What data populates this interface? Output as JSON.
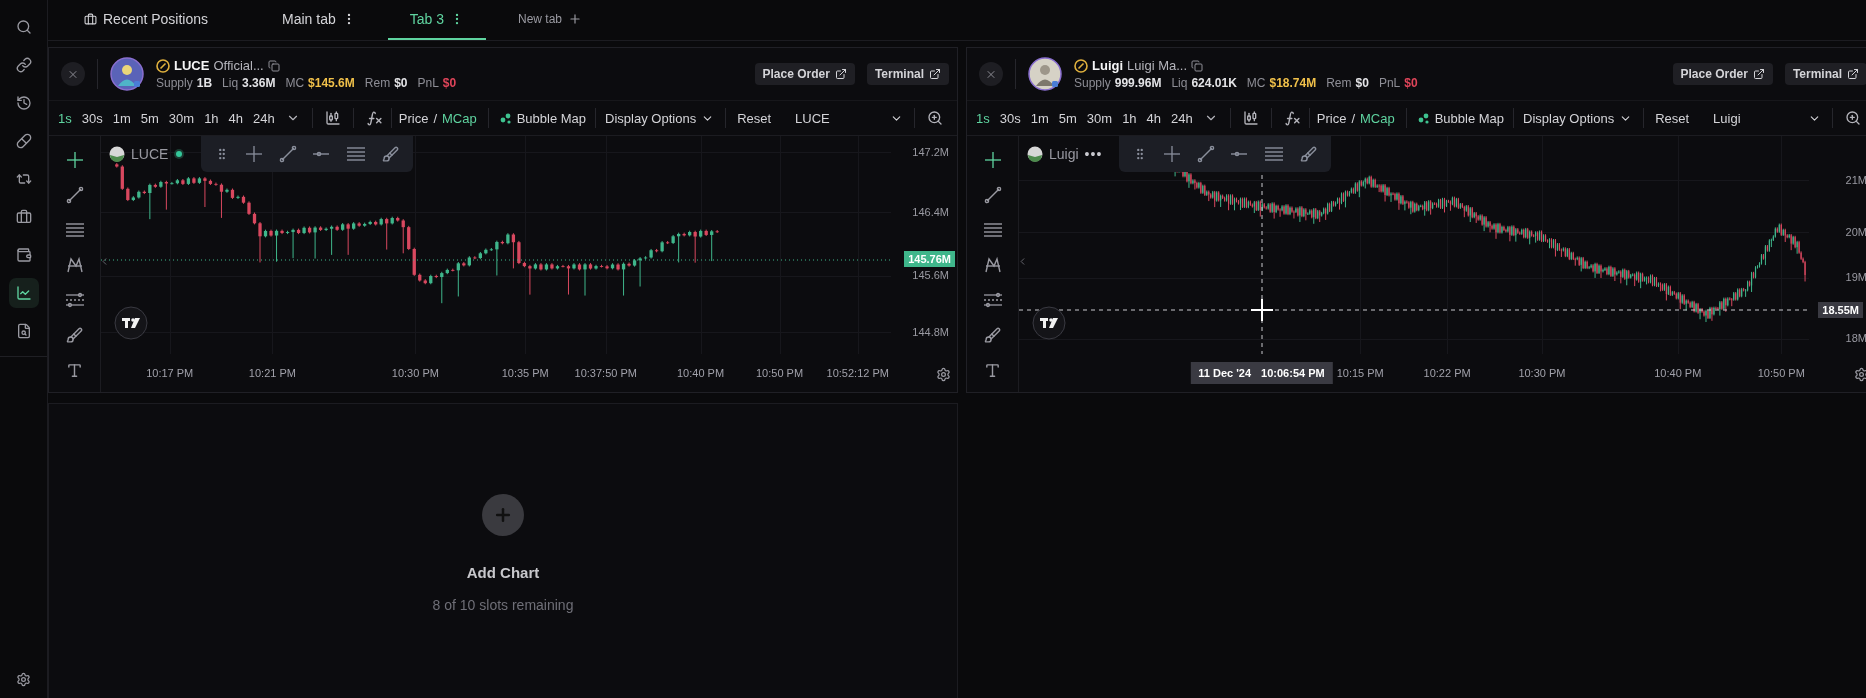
{
  "sidebar": {
    "items": [
      {
        "selected": false
      },
      {
        "selected": false
      },
      {
        "selected": false
      },
      {
        "selected": false
      },
      {
        "selected": false
      },
      {
        "selected": false
      },
      {
        "selected": false
      },
      {
        "selected": true
      },
      {
        "selected": false
      }
    ]
  },
  "tabs": [
    {
      "label": "Recent Positions",
      "kind": "pinned",
      "selected": false
    },
    {
      "label": "Main tab",
      "kind": "tab",
      "selected": false
    },
    {
      "label": "Tab 3",
      "kind": "tab",
      "selected": true
    },
    {
      "label": "New tab",
      "kind": "new",
      "selected": false
    }
  ],
  "panels": [
    {
      "symbol": "LUCE",
      "name": "Official...",
      "stats": [
        {
          "label": "Supply",
          "value": "1B",
          "color": "#e4e4e7"
        },
        {
          "label": "Liq",
          "value": "3.36M",
          "color": "#e4e4e7"
        },
        {
          "label": "MC",
          "value": "$145.6M",
          "color": "#f0c04a"
        },
        {
          "label": "Rem",
          "value": "$0",
          "color": "#e4e4e7"
        },
        {
          "label": "PnL",
          "value": "$0",
          "color": "#e0455a"
        }
      ],
      "actions": [
        "Place Order",
        "Terminal"
      ],
      "intervals": [
        {
          "label": "1s",
          "selected": true
        },
        {
          "label": "30s",
          "selected": false
        },
        {
          "label": "1m",
          "selected": false
        },
        {
          "label": "5m",
          "selected": false
        },
        {
          "label": "30m",
          "selected": false
        },
        {
          "label": "1h",
          "selected": false
        },
        {
          "label": "4h",
          "selected": false
        },
        {
          "label": "24h",
          "selected": false
        }
      ],
      "value_modes": [
        {
          "label": "Price",
          "selected": false
        },
        {
          "label": "MCap",
          "selected": true
        }
      ],
      "mode_separator": "/",
      "bubble_map": "Bubble Map",
      "display_options": "Display Options",
      "reset": "Reset",
      "instrument": "LUCE",
      "chart": {
        "legend": "LUCE",
        "live": true,
        "price_ticks": [
          "147.2M",
          "146.4M",
          "145.6M",
          "144.8M"
        ],
        "last_price": "145.76M",
        "time_ticks": [
          "10:17 PM",
          "10:21 PM",
          "10:30 PM",
          "10:35 PM",
          "10:37:50 PM",
          "10:40 PM",
          "10:50 PM",
          "10:52:12 PM"
        ]
      }
    },
    {
      "symbol": "Luigi",
      "name": "Luigi Ma...",
      "stats": [
        {
          "label": "Supply",
          "value": "999.96M",
          "color": "#e4e4e7"
        },
        {
          "label": "Liq",
          "value": "624.01K",
          "color": "#e4e4e7"
        },
        {
          "label": "MC",
          "value": "$18.74M",
          "color": "#f0c04a"
        },
        {
          "label": "Rem",
          "value": "$0",
          "color": "#e4e4e7"
        },
        {
          "label": "PnL",
          "value": "$0",
          "color": "#e0455a"
        }
      ],
      "actions": [
        "Place Order",
        "Terminal"
      ],
      "intervals": [
        {
          "label": "1s",
          "selected": true
        },
        {
          "label": "30s",
          "selected": false
        },
        {
          "label": "1m",
          "selected": false
        },
        {
          "label": "5m",
          "selected": false
        },
        {
          "label": "30m",
          "selected": false
        },
        {
          "label": "1h",
          "selected": false
        },
        {
          "label": "4h",
          "selected": false
        },
        {
          "label": "24h",
          "selected": false
        }
      ],
      "value_modes": [
        {
          "label": "Price",
          "selected": false
        },
        {
          "label": "MCap",
          "selected": true
        }
      ],
      "mode_separator": "/",
      "bubble_map": "Bubble Map",
      "display_options": "Display Options",
      "reset": "Reset",
      "instrument": "Luigi",
      "chart": {
        "legend": "Luigi",
        "menu": "•••",
        "price_ticks": [
          "21M",
          "20M",
          "19M",
          "18M"
        ],
        "crosshair": {
          "date": "11 Dec '24",
          "time": "10:06:54 PM",
          "price": "18.55M"
        },
        "time_ticks": [
          "10:15 PM",
          "10:22 PM",
          "10:30 PM",
          "10:40 PM",
          "10:50 PM"
        ]
      }
    }
  ],
  "add_chart": {
    "title": "Add Chart",
    "subtitle": "8 of 10 slots remaining"
  }
}
